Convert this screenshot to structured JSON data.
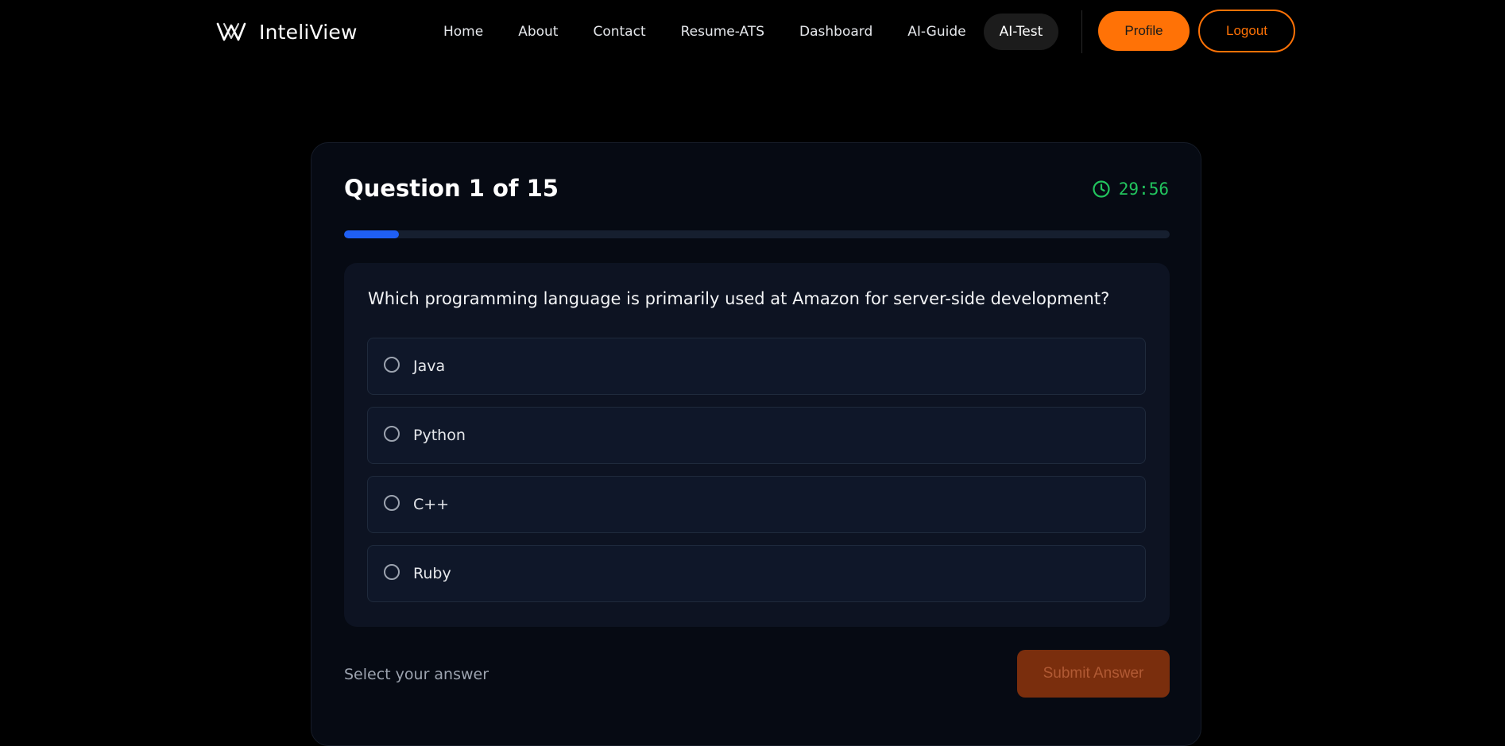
{
  "nav": {
    "brand_name": "InteliView",
    "links": [
      {
        "label": "Home"
      },
      {
        "label": "About"
      },
      {
        "label": "Contact"
      },
      {
        "label": "Resume-ATS"
      },
      {
        "label": "Dashboard"
      },
      {
        "label": "AI-Guide"
      },
      {
        "label": "AI-Test",
        "active": true
      }
    ],
    "profile_label": "Profile",
    "logout_label": "Logout"
  },
  "quiz": {
    "title": "Question 1 of 15",
    "timer": "29:56",
    "progress": 0.0667,
    "question": "Which programming language is primarily used at Amazon for server-side development?",
    "options": [
      {
        "label": "Java"
      },
      {
        "label": "Python"
      },
      {
        "label": "C++"
      },
      {
        "label": "Ruby"
      }
    ],
    "hint": "Select your answer",
    "submit_label": "Submit Answer"
  },
  "colors": {
    "accent_orange": "#ff7206",
    "progress_blue": "#1f5ff3",
    "timer_green": "#22c55e",
    "submit_disabled": "#7a2e0d"
  },
  "icons": {
    "brand": "inteliview-logo-icon",
    "timer": "clock-icon",
    "option": "radio-unchecked-icon"
  }
}
